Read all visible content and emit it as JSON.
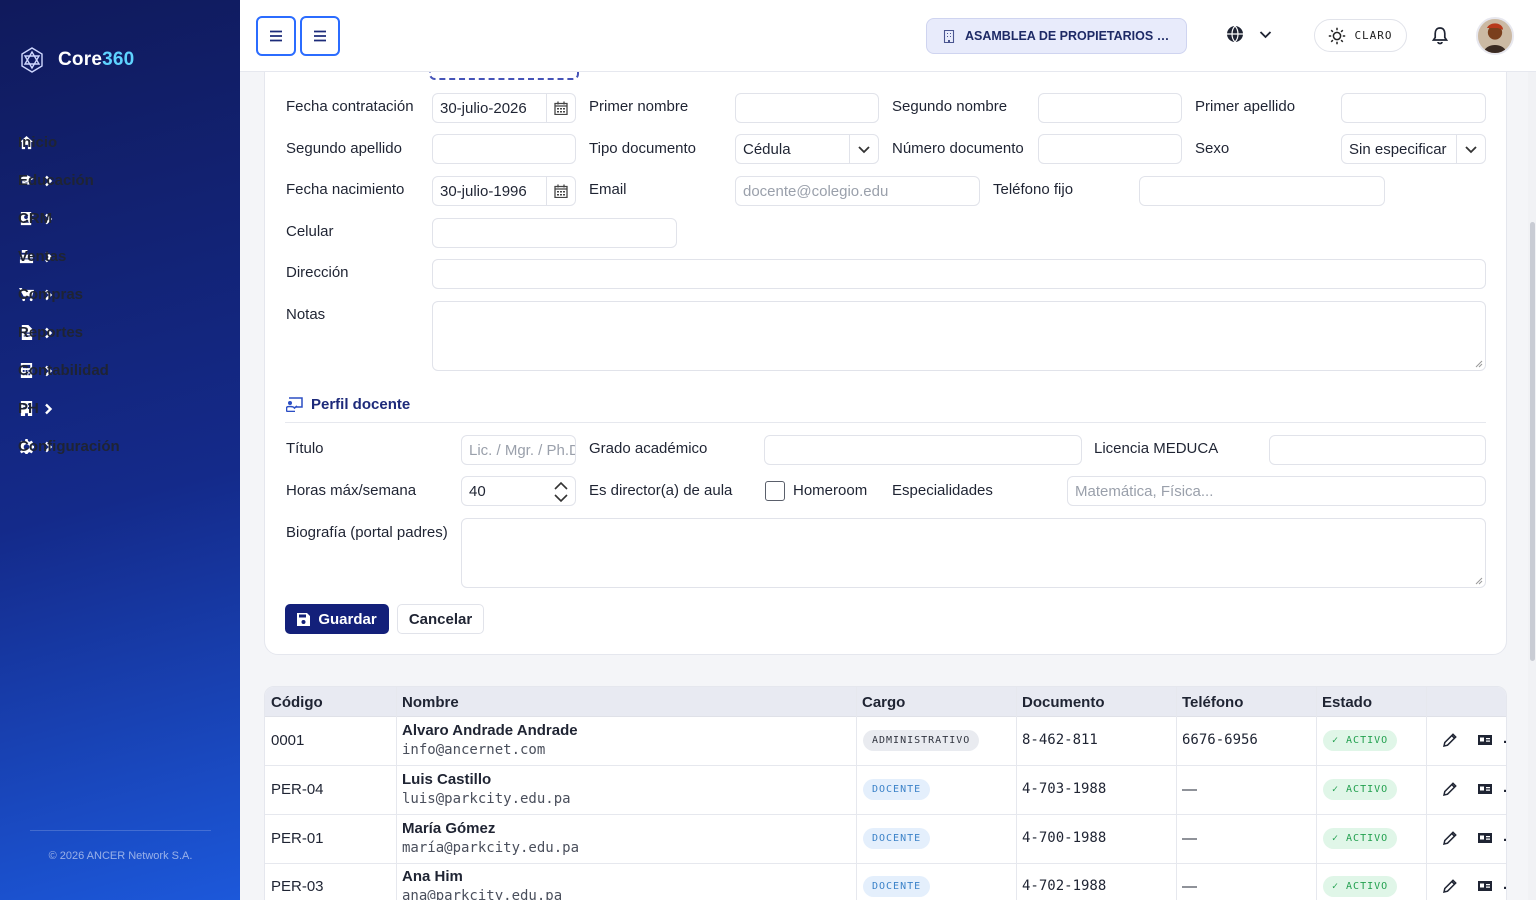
{
  "brand": {
    "name_main": "Core",
    "name_accent": "360"
  },
  "sidebar": {
    "items": [
      {
        "label": "Inicio",
        "icon": "home-icon"
      },
      {
        "label": "Educación",
        "icon": "graduation-cap-icon"
      },
      {
        "label": "CRM",
        "icon": "address-book-icon"
      },
      {
        "label": "Ventas",
        "icon": "cash-register-icon"
      },
      {
        "label": "Compras",
        "icon": "cart-icon"
      },
      {
        "label": "Reportes",
        "icon": "file-report-icon"
      },
      {
        "label": "Contabilidad",
        "icon": "calculator-icon"
      },
      {
        "label": "PH",
        "icon": "building-icon"
      },
      {
        "label": "Configuración",
        "icon": "gear-icon"
      }
    ],
    "footer": "© 2026 ANCER Network S.A."
  },
  "topbar": {
    "org": "ASAMBLEA DE PROPIETARIOS DE PH PARK CITY",
    "theme_label": "CLARO"
  },
  "form": {
    "fecha_contratacion_label": "Fecha contratación",
    "fecha_contratacion_value": "30-julio-2026",
    "primer_nombre_label": "Primer nombre",
    "segundo_nombre_label": "Segundo nombre",
    "primer_apellido_label": "Primer apellido",
    "segundo_apellido_label": "Segundo apellido",
    "tipo_documento_label": "Tipo documento",
    "tipo_documento_value": "Cédula",
    "numero_documento_label": "Número documento",
    "sexo_label": "Sexo",
    "sexo_value": "Sin especificar",
    "fecha_nacimiento_label": "Fecha nacimiento",
    "fecha_nacimiento_value": "30-julio-1996",
    "email_label": "Email",
    "email_placeholder": "docente@colegio.edu",
    "telefono_fijo_label": "Teléfono fijo",
    "celular_label": "Celular",
    "direccion_label": "Dirección",
    "notas_label": "Notas",
    "perfil_title": "Perfil docente",
    "titulo_label": "Título",
    "titulo_placeholder": "Lic. / Mgr. / Ph.D.",
    "grado_label": "Grado académico",
    "licencia_label": "Licencia MEDUCA",
    "horas_label": "Horas máx/semana",
    "horas_value": "40",
    "director_label": "Es director(a) de aula",
    "homeroom_label": "Homeroom",
    "homeroom_checked": false,
    "especialidades_label": "Especialidades",
    "especialidades_placeholder": "Matemática, Física...",
    "biografia_label": "Biografía (portal padres)",
    "save_label": "Guardar",
    "cancel_label": "Cancelar"
  },
  "table": {
    "headers": [
      "Código",
      "Nombre",
      "Cargo",
      "Documento",
      "Teléfono",
      "Estado"
    ],
    "rows": [
      {
        "codigo": "0001",
        "nombre": "Alvaro Andrade Andrade",
        "email": "info@ancernet.com",
        "cargo": "ADMINISTRATIVO",
        "documento": "8-462-811",
        "telefono": "6676-6956",
        "estado": "✓ ACTIVO"
      },
      {
        "codigo": "PER-04",
        "nombre": "Luis Castillo",
        "email": "luis@parkcity.edu.pa",
        "cargo": "DOCENTE",
        "documento": "4-703-1988",
        "telefono": "—",
        "estado": "✓ ACTIVO"
      },
      {
        "codigo": "PER-01",
        "nombre": "María Gómez",
        "email": "maría@parkcity.edu.pa",
        "cargo": "DOCENTE",
        "documento": "4-700-1988",
        "telefono": "—",
        "estado": "✓ ACTIVO"
      },
      {
        "codigo": "PER-03",
        "nombre": "Ana Him",
        "email": "ana@parkcity.edu.pa",
        "cargo": "DOCENTE",
        "documento": "4-702-1988",
        "telefono": "—",
        "estado": "✓ ACTIVO"
      }
    ]
  },
  "colors": {
    "primary": "#13207a",
    "accent": "#2b6cff",
    "success": "#22a04f",
    "info": "#3b82c8"
  }
}
